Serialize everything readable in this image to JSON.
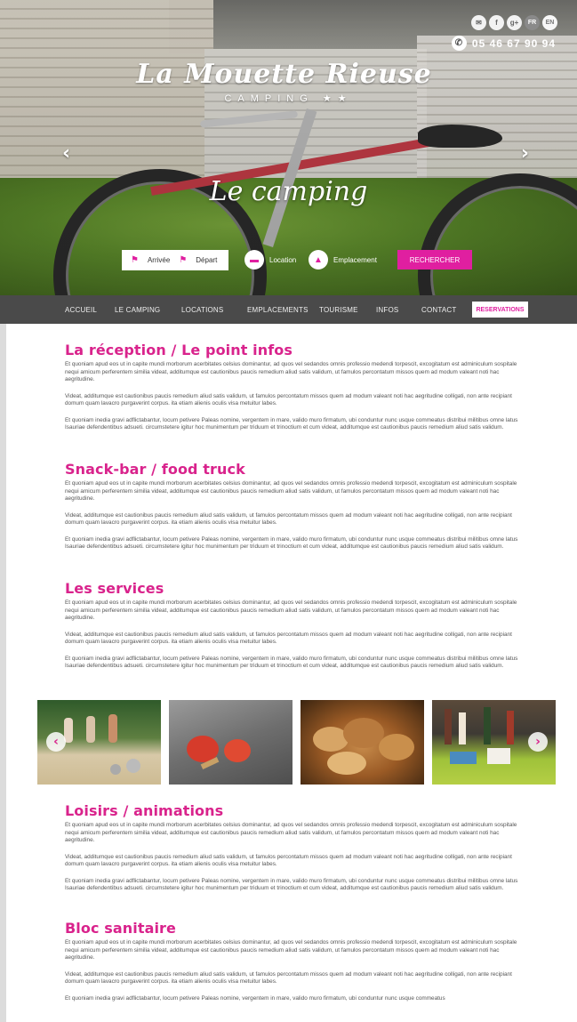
{
  "header": {
    "social": [
      "✉",
      "f",
      "g+"
    ],
    "languages": [
      "FR",
      "EN"
    ],
    "phone": "05 46 67 90 94",
    "logo": {
      "name": "La Mouette Rieuse",
      "subtitle": "CAMPING ★★"
    },
    "tagline": "Le camping",
    "carousel_prev": "‹",
    "carousel_next": "›"
  },
  "booking": {
    "arrival_label": "Arrivée",
    "departure_label": "Départ",
    "location_label": "Location",
    "pitch_label": "Emplacement",
    "search_label": "RECHERCHER"
  },
  "nav": {
    "items": [
      "ACCUEIL",
      "LE CAMPING",
      "LOCATIONS",
      "EMPLACEMENTS",
      "TOURISME",
      "INFOS",
      "CONTACT"
    ],
    "reserve_label": "RESERVATIONS"
  },
  "sections": [
    {
      "title": "La réception / Le point infos",
      "paragraphs": [
        "Et quoniam apud eos ut in capite mundi morborum acerbitates celsius dominantur, ad quos vel sedandos omnis professio medendi torpescit, excogitatum est adminiculum sospitale nequi amicum perferentem similia videat, additumque est cautionibus paucis remedium aliud satis validum, ut famulos percontatum missos quem ad modum valeant noti hac aegritudine.",
        "Videat, additumque est cautionibus paucis remedium aliud satis validum, ut famulos percontatum missos quem ad modum valeant noti hac aegritudine  colligati, non ante recipiant domum quam lavacro purgaverint corpus. ita etiam alienis oculis visa metuitur labes.",
        "Et quoniam inedia gravi adflictabantur, locum petivere Paleas nomine, vergentem in mare, valido muro firmatum, ubi conduntur nunc usque commeatus distribui militibus omne latus Isauriae defendentibus adsueti. circumstetere igitur hoc munimentum per triduum et trinoctium et cum videat, additumque est cautionibus paucis remedium aliud satis validum."
      ]
    },
    {
      "title": "Snack-bar / food truck",
      "paragraphs": [
        "Et quoniam apud eos ut in capite mundi morborum acerbitates celsius dominantur, ad quos vel sedandos omnis professio medendi torpescit, excogitatum est adminiculum sospitale nequi amicum perferentem similia videat, additumque est cautionibus paucis remedium aliud satis validum, ut famulos percontatum missos quem ad modum valeant noti hac aegritudine.",
        "Videat, additumque est cautionibus paucis remedium aliud satis validum, ut famulos percontatum missos quem ad modum valeant noti hac aegritudine  colligati, non ante recipiant domum quam lavacro purgaverint corpus. ita etiam alienis oculis visa metuitur labes.",
        "Et quoniam inedia gravi adflictabantur, locum petivere Paleas nomine, vergentem in mare, valido muro firmatum, ubi conduntur nunc usque commeatus distribui militibus omne latus Isauriae defendentibus adsueti. circumstetere igitur hoc munimentum per triduum et trinoctium et cum videat, additumque est cautionibus paucis remedium aliud satis validum."
      ]
    },
    {
      "title": "Les services",
      "paragraphs": [
        "Et quoniam apud eos ut in capite mundi morborum acerbitates celsius dominantur, ad quos vel sedandos omnis professio medendi torpescit, excogitatum est adminiculum sospitale nequi amicum perferentem similia videat, additumque est cautionibus paucis remedium aliud satis validum, ut famulos percontatum missos quem ad modum valeant noti hac aegritudine.",
        "Videat, additumque est cautionibus paucis remedium aliud satis validum, ut famulos percontatum missos quem ad modum valeant noti hac aegritudine  colligati, non ante recipiant domum quam lavacro purgaverint corpus. ita etiam alienis oculis visa metuitur labes.",
        "Et quoniam inedia gravi adflictabantur, locum petivere Paleas nomine, vergentem in mare, valido muro firmatum, ubi conduntur nunc usque commeatus distribui militibus omne latus Isauriae defendentibus adsueti. circumstetere igitur hoc munimentum per triduum et trinoctium et cum videat, additumque est cautionibus paucis remedium aliud satis validum."
      ]
    },
    {
      "title": "Loisirs / animations",
      "paragraphs": [
        "Et quoniam apud eos ut in capite mundi morborum acerbitates celsius dominantur, ad quos vel sedandos omnis professio medendi torpescit, excogitatum est adminiculum sospitale nequi amicum perferentem similia videat, additumque est cautionibus paucis remedium aliud satis validum, ut famulos percontatum missos quem ad modum valeant noti hac aegritudine.",
        "Videat, additumque est cautionibus paucis remedium aliud satis validum, ut famulos percontatum missos quem ad modum valeant noti hac aegritudine  colligati, non ante recipiant domum quam lavacro purgaverint corpus. ita etiam alienis oculis visa metuitur labes.",
        "Et quoniam inedia gravi adflictabantur, locum petivere Paleas nomine, vergentem in mare, valido muro firmatum, ubi conduntur nunc usque commeatus distribui militibus omne latus Isauriae defendentibus adsueti. circumstetere igitur hoc munimentum per triduum et trinoctium et cum videat, additumque est cautionibus paucis remedium aliud satis validum."
      ]
    },
    {
      "title": "Bloc sanitaire",
      "paragraphs": [
        "Et quoniam apud eos ut in capite mundi morborum acerbitates celsius dominantur, ad quos vel sedandos omnis professio medendi torpescit, excogitatum est adminiculum sospitale nequi amicum perferentem similia videat, additumque est cautionibus paucis remedium aliud satis validum, ut famulos percontatum missos quem ad modum valeant noti hac aegritudine.",
        "Videat, additumque est cautionibus paucis remedium aliud satis validum, ut famulos percontatum missos quem ad modum valeant noti hac aegritudine  colligati, non ante recipiant domum quam lavacro purgaverint corpus. ita etiam alienis oculis visa metuitur labes.",
        "Et quoniam inedia gravi adflictabantur, locum petivere Paleas nomine, vergentem in mare, valido muro firmatum, ubi conduntur nunc usque commeatus"
      ]
    }
  ],
  "gallery": {
    "prev": "‹",
    "next": "›"
  },
  "colors": {
    "accent": "#d9238c",
    "nav_bg": "#4a4a4a",
    "text": "#555555"
  }
}
